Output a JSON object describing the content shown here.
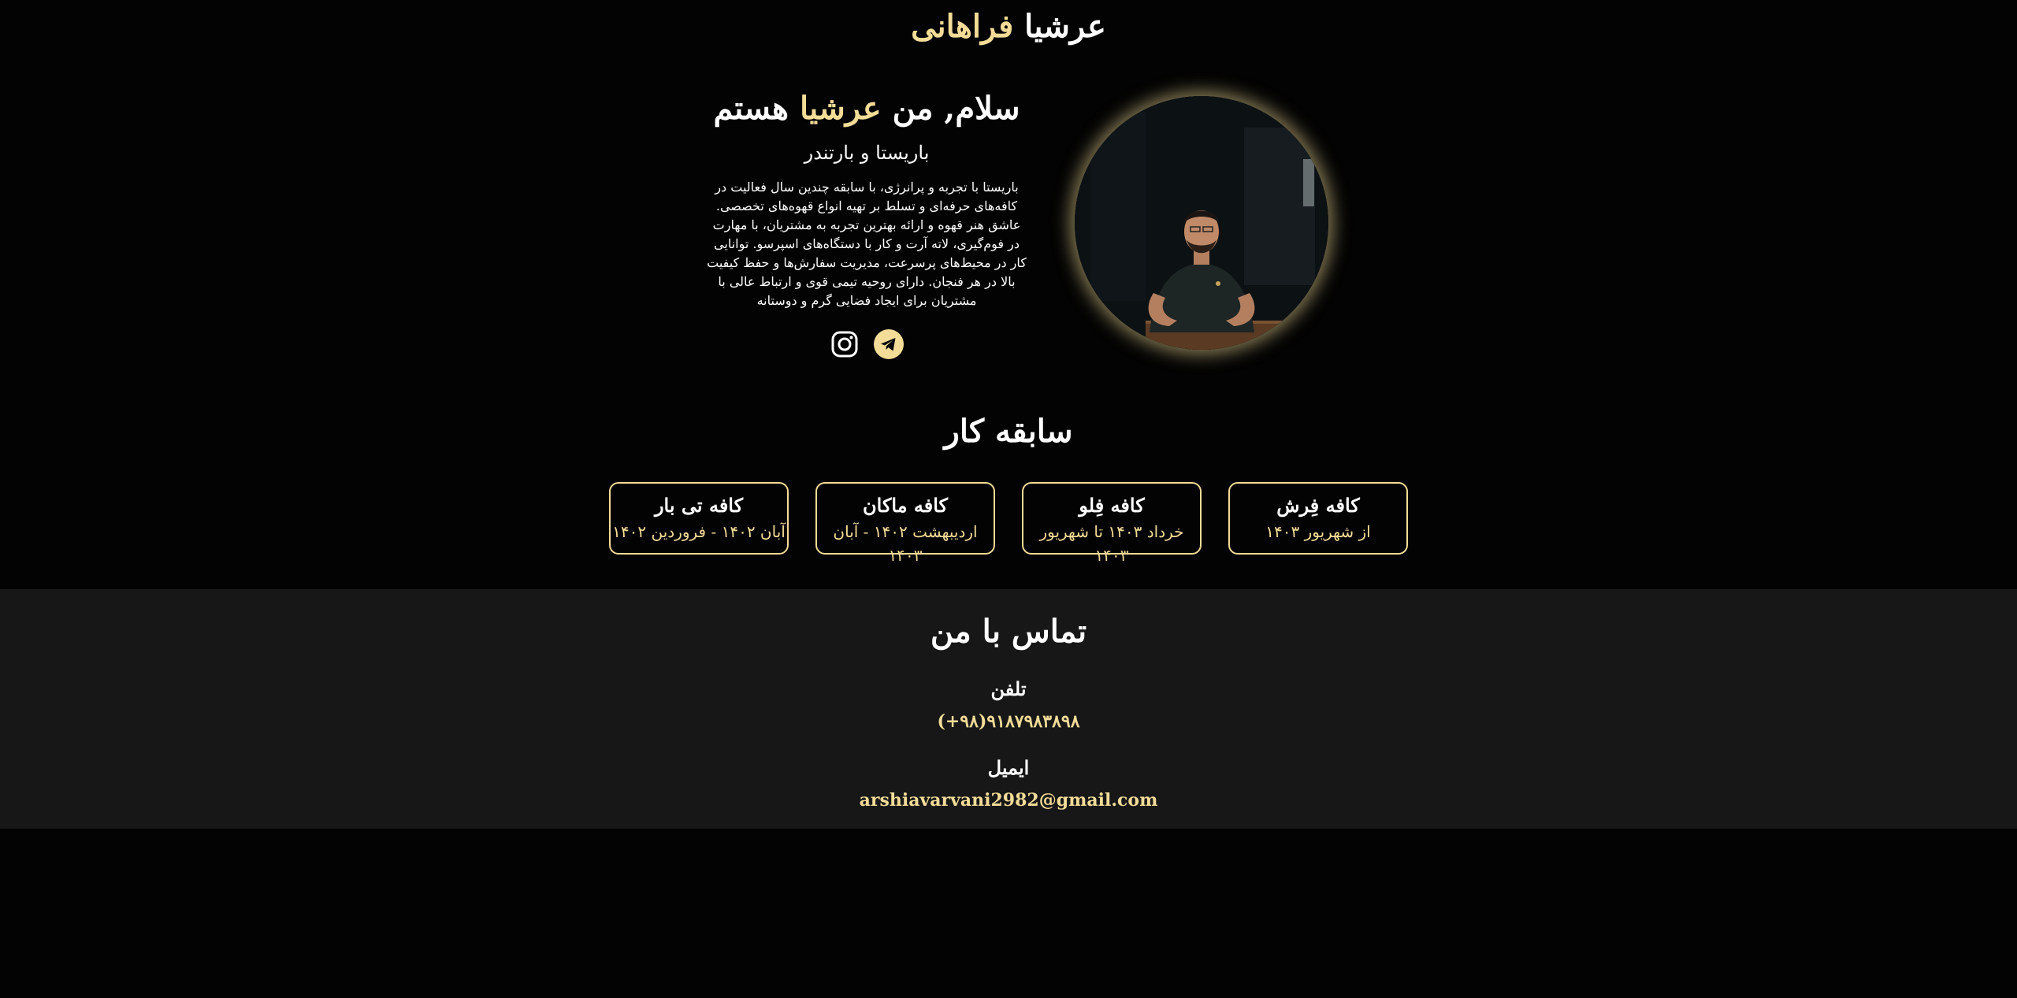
{
  "header": {
    "title_first": "عرشیا",
    "title_last": "فراهانی"
  },
  "hero": {
    "greeting_prefix": "سلام, من",
    "greeting_name": "عرشیا",
    "greeting_suffix": "هستم",
    "role": "باریستا و بارتندر",
    "bio": "باریستا با تجربه و پرانرژی، با سابقه چندین سال فعالیت در کافه‌های حرفه‌ای و تسلط بر تهیه انواع قهوه‌های تخصصی. عاشق هنر قهوه و ارائه بهترین تجربه به مشتریان، با مهارت در فوم‌گیری، لاته آرت و کار با دستگاه‌های اسپرسو. توانایی کار در محیط‌های پرسرعت، مدیریت سفارش‌ها و حفظ کیفیت بالا در هر فنجان. دارای روحیه تیمی قوی و ارتباط عالی با مشتریان برای ایجاد فضایی گرم و دوستانه",
    "socials": [
      {
        "icon": "telegram-icon"
      },
      {
        "icon": "instagram-icon"
      }
    ]
  },
  "experience": {
    "title": "سابقه کار",
    "items": [
      {
        "name": "کافه فِرش",
        "period": "از شهریور ۱۴۰۳"
      },
      {
        "name": "کافه فِلو",
        "period": "خرداد ۱۴۰۳ تا شهریور ۱۴۰۳"
      },
      {
        "name": "کافه ماکان",
        "period": "اردیبهشت ۱۴۰۲ - آبان ۱۴۰۳"
      },
      {
        "name": "کافه تی بار",
        "period": "آبان ۱۴۰۲ - فروردین ۱۴۰۲"
      }
    ]
  },
  "contact": {
    "title": "تماس با من",
    "phone_label": "تلفن",
    "phone_value": "(+۹۸)۹۱۸۷۹۸۳۸۹۸",
    "email_label": "ایمیل",
    "email_value": "arshiavarvani2982@gmail.com"
  },
  "colors": {
    "accent": "#f3dc97",
    "background": "#030303",
    "contact_background": "#171717"
  }
}
